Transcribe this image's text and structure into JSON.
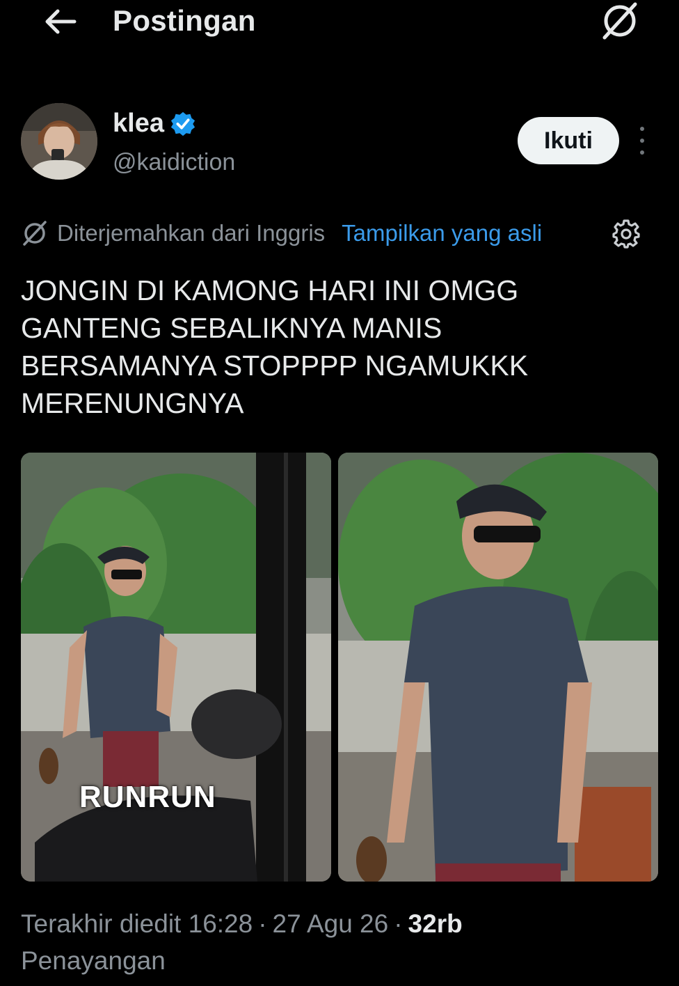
{
  "header": {
    "title": "Postingan"
  },
  "author": {
    "display_name": "klea",
    "handle": "@kaidiction",
    "follow_label": "Ikuti"
  },
  "translation": {
    "notice": "Diterjemahkan dari Inggris",
    "show_original": "Tampilkan yang asli"
  },
  "tweet": {
    "lines": [
      "JONGIN DI KAMONG HARI INI OMGG",
      "GANTENG SEBALIKNYA MANIS",
      "BERSAMANYA STOPPPP NGAMUKKK",
      "MERENUNGNYA"
    ],
    "watermark": "RUNRUN"
  },
  "meta": {
    "edited_label": "Terakhir diedit",
    "time": "16:28",
    "date": "27 Agu 26",
    "views_count": "32rb",
    "views_label": "Penayangan",
    "separator": "·"
  },
  "colors": {
    "background": "#000000",
    "text": "#e7e9ea",
    "secondary": "#8b9299",
    "link": "#3b9bea",
    "verified": "#1d9bf0"
  }
}
